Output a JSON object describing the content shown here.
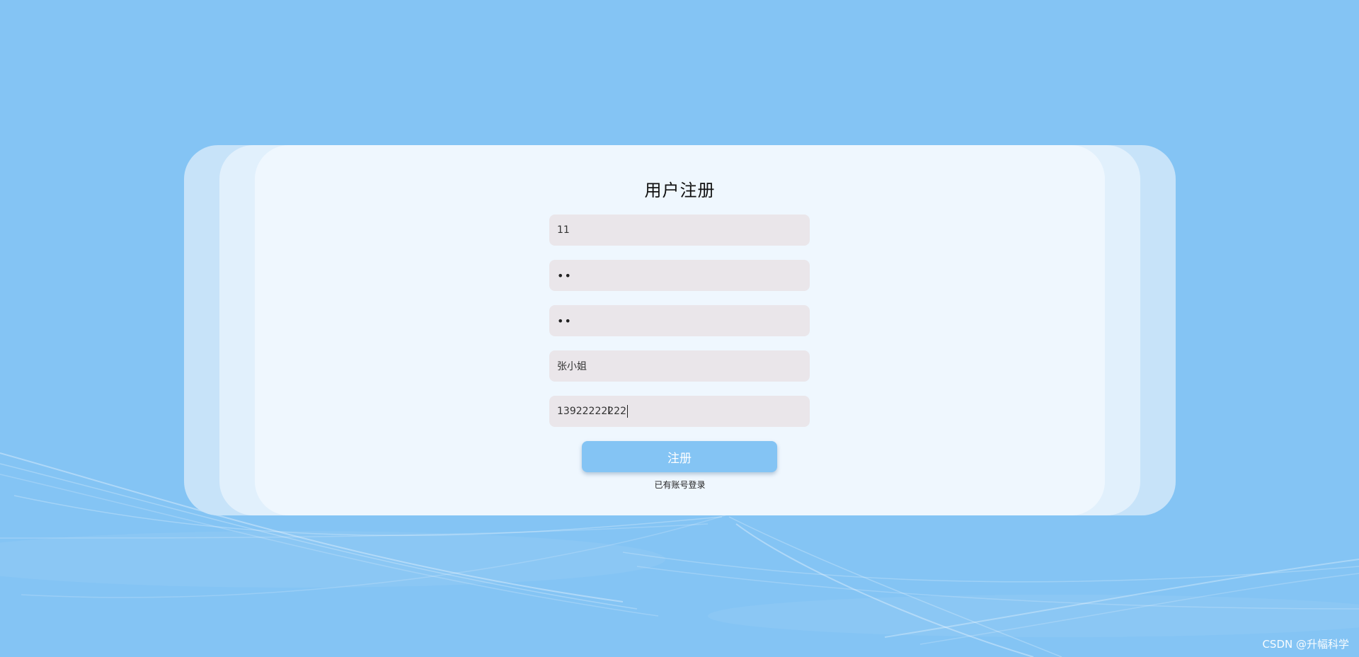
{
  "form": {
    "title": "用户注册",
    "fields": [
      {
        "name": "username",
        "value": "11"
      },
      {
        "name": "password",
        "value": "••"
      },
      {
        "name": "confirm-password",
        "value": "••"
      },
      {
        "name": "realname",
        "value": "张小姐"
      },
      {
        "name": "phone",
        "value": "13922222222"
      }
    ],
    "submit_label": "注册",
    "login_link": "已有账号登录"
  },
  "watermark": "CSDN @升幅科学",
  "colors": {
    "background": "#84c4f4",
    "card": "#eff7fe",
    "input": "#eae6ea",
    "button": "#84c4f4"
  }
}
